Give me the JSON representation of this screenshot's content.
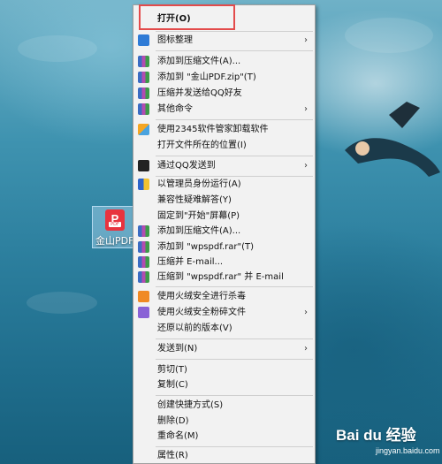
{
  "desktop": {
    "icon_label": "金山PDF",
    "icon_glyph": "P",
    "icon_tag": "PDF"
  },
  "menu": {
    "items": [
      {
        "label": "打开(O)",
        "icon": "none"
      },
      {
        "label": "图标整理",
        "icon": "monitor-icon",
        "submenu": "›"
      },
      {
        "label": "添加到压缩文件(A)...",
        "icon": "winrar-icon"
      },
      {
        "label": "添加到 \"金山PDF.zip\"(T)",
        "icon": "winrar-icon"
      },
      {
        "label": "压缩并发送给QQ好友",
        "icon": "winrar-icon"
      },
      {
        "label": "其他命令",
        "icon": "winrar-icon",
        "submenu": "›"
      },
      {
        "label": "使用2345软件管家卸载软件",
        "icon": "2345-icon"
      },
      {
        "label": "打开文件所在的位置(I)",
        "icon": "none"
      },
      {
        "label": "通过QQ发送到",
        "icon": "qq-icon",
        "submenu": "›"
      },
      {
        "label": "以管理员身份运行(A)",
        "icon": "shield-icon"
      },
      {
        "label": "兼容性疑难解答(Y)",
        "icon": "none"
      },
      {
        "label": "固定到\"开始\"屏幕(P)",
        "icon": "none"
      },
      {
        "label": "添加到压缩文件(A)...",
        "icon": "winrar-icon"
      },
      {
        "label": "添加到 \"wpspdf.rar\"(T)",
        "icon": "winrar-icon"
      },
      {
        "label": "压缩并 E-mail...",
        "icon": "winrar-icon"
      },
      {
        "label": "压缩到 \"wpspdf.rar\" 并 E-mail",
        "icon": "winrar-icon"
      },
      {
        "label": "使用火绒安全进行杀毒",
        "icon": "huorong-icon"
      },
      {
        "label": "使用火绒安全粉碎文件",
        "icon": "shredder-icon",
        "submenu": "›"
      },
      {
        "label": "还原以前的版本(V)",
        "icon": "none"
      },
      {
        "label": "发送到(N)",
        "icon": "none",
        "submenu": "›"
      },
      {
        "label": "剪切(T)",
        "icon": "none"
      },
      {
        "label": "复制(C)",
        "icon": "none"
      },
      {
        "label": "创建快捷方式(S)",
        "icon": "none"
      },
      {
        "label": "删除(D)",
        "icon": "none"
      },
      {
        "label": "重命名(M)",
        "icon": "none"
      },
      {
        "label": "属性(R)",
        "icon": "none"
      }
    ]
  },
  "watermark": {
    "brand": "Bai du 经验",
    "url": "jingyan.baidu.com"
  }
}
